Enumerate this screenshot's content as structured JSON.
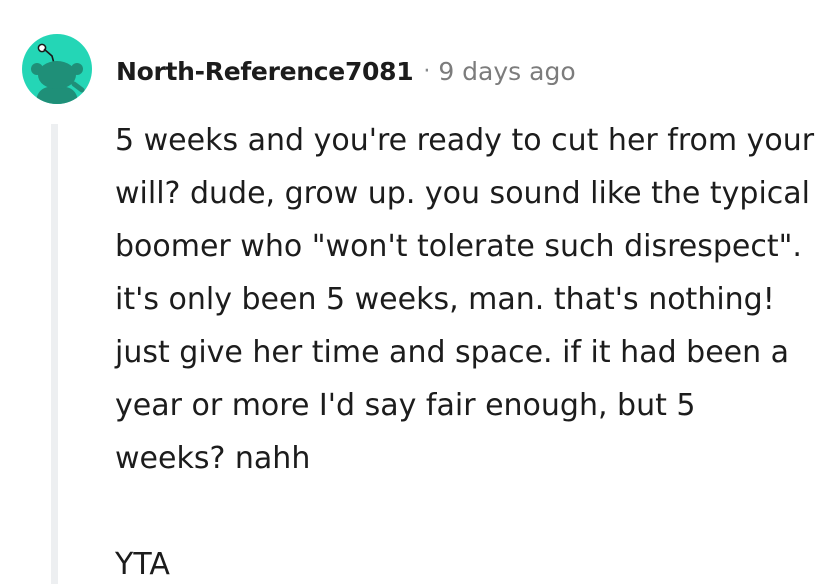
{
  "comment": {
    "author": "North-Reference7081",
    "separator": "·",
    "timestamp": "9 days ago",
    "avatar_icon": "reddit-snoo-avatar",
    "avatar_color": "#24d6b6",
    "body_paragraph": "5 weeks and you're ready to cut her from your will? dude, grow up. you sound like the typical boomer who \"won't tolerate such disrespect\". it's only been 5 weeks, man. that's nothing! just give her time and space. if it had been a year or more I'd say fair enough, but 5 weeks? nahh",
    "verdict": "YTA"
  }
}
